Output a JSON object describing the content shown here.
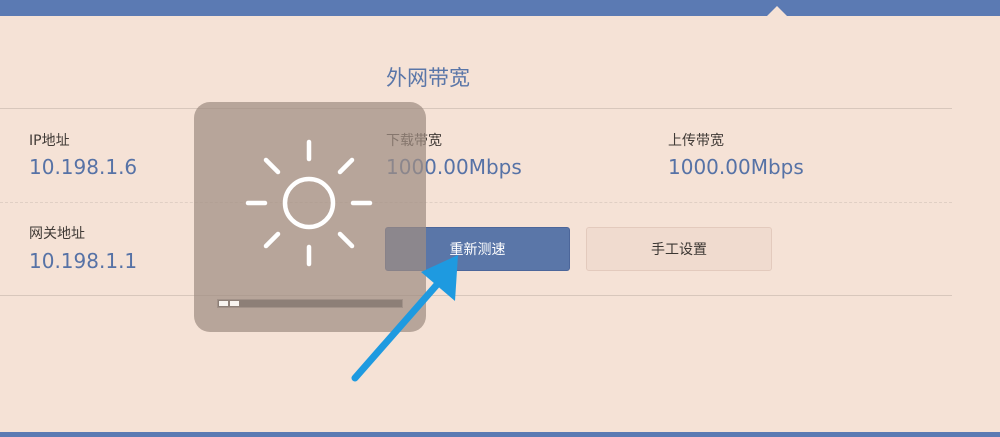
{
  "header": {
    "title": "外网带宽"
  },
  "network": {
    "ip_label": "IP地址",
    "ip_value": "10.198.1.6",
    "gateway_label": "网关地址",
    "gateway_value": "10.198.1.1"
  },
  "bandwidth": {
    "download_label": "下载带宽",
    "download_value": "1000.00Mbps",
    "upload_label": "上传带宽",
    "upload_value": "1000.00Mbps"
  },
  "actions": {
    "retest_label": "重新测速",
    "manual_label": "手工设置"
  },
  "loading": {
    "icon": "brightness-icon",
    "progress_segments": 2
  },
  "colors": {
    "accent": "#5a76a8",
    "background": "#f5e2d6",
    "pointer_arrow": "#1e9ae0"
  }
}
